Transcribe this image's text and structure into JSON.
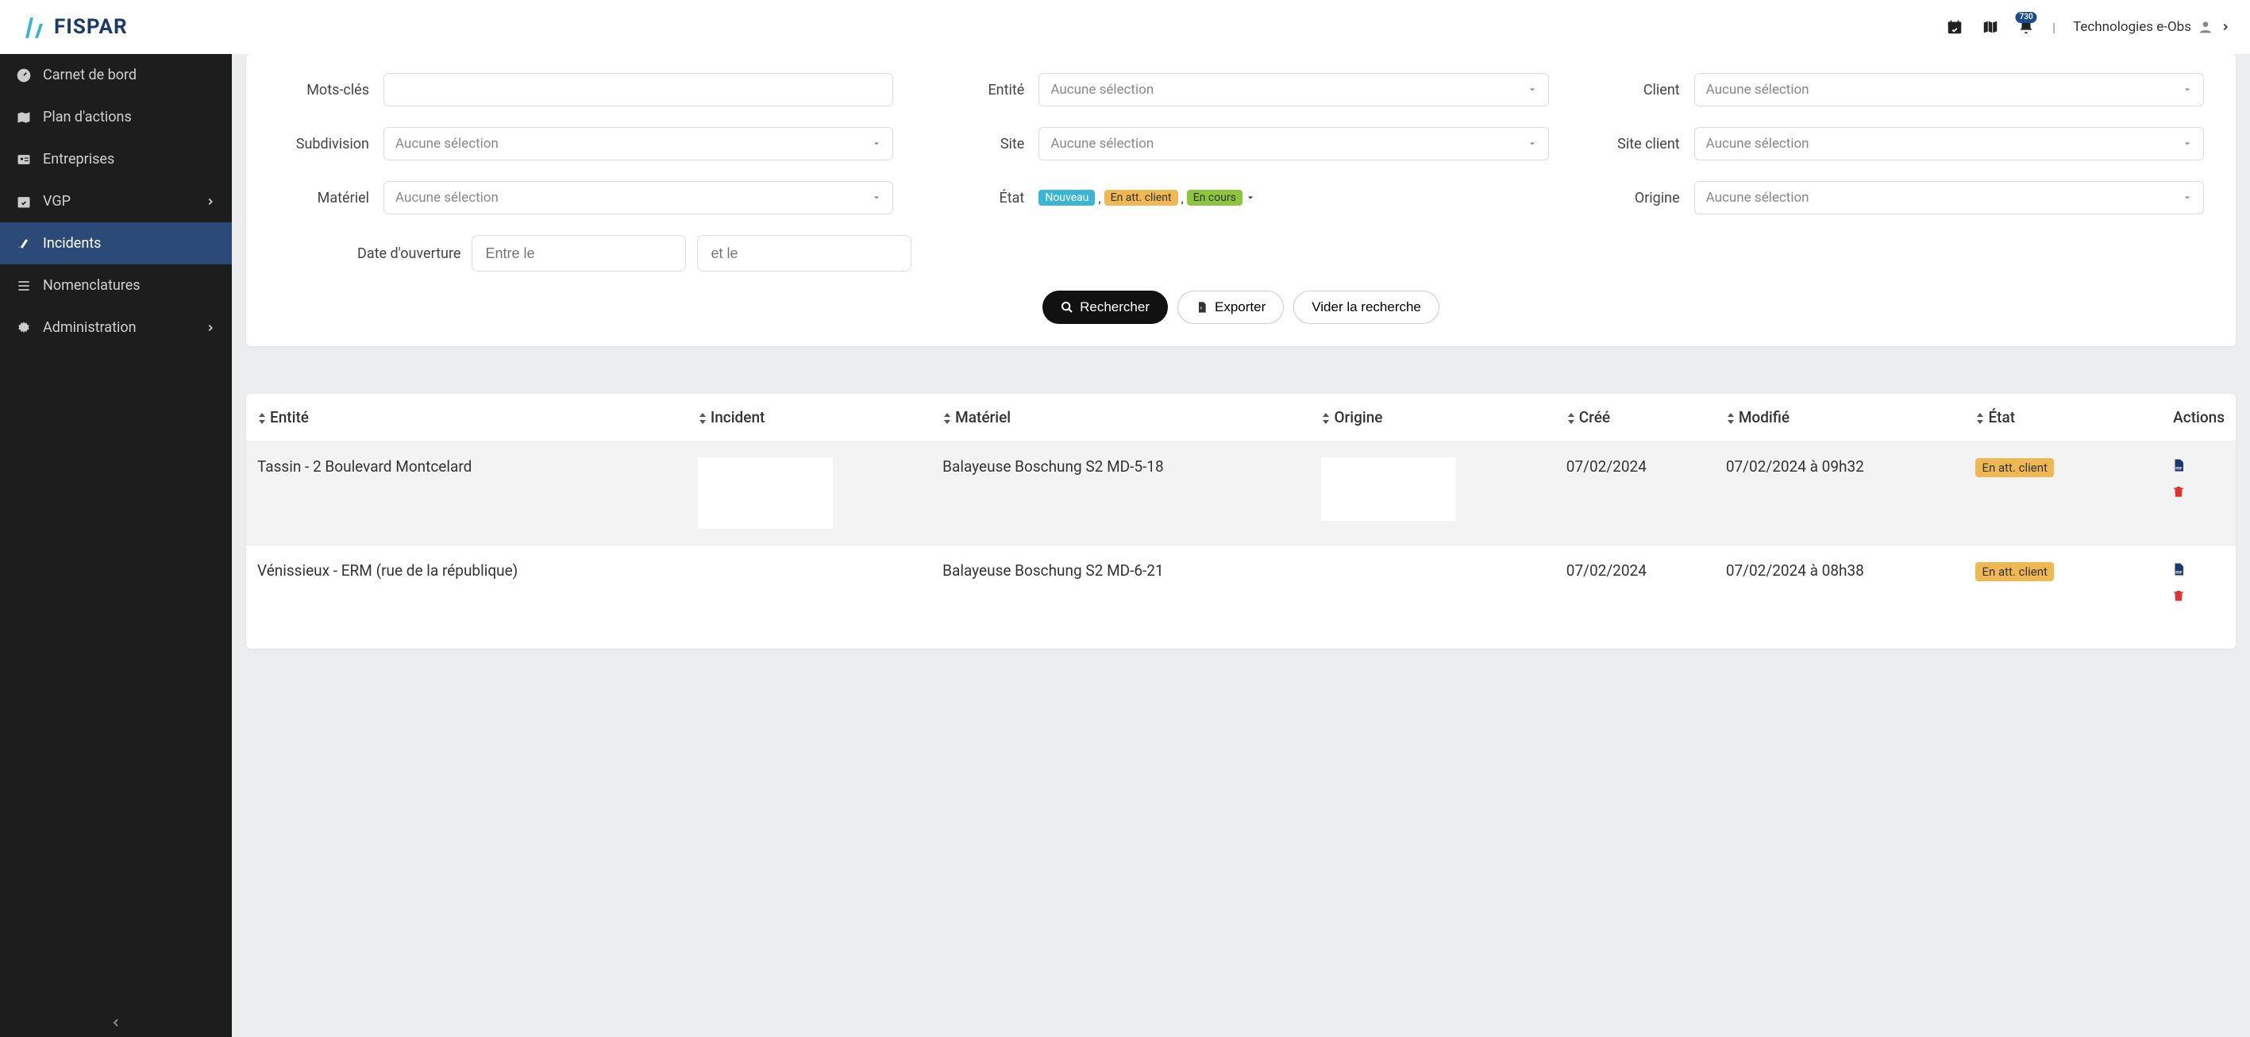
{
  "brand": "FISPAR",
  "notif_count": "730",
  "user_label": "Technologies e-Obs",
  "sidebar": {
    "items": [
      {
        "label": "Carnet de bord",
        "icon": "dashboard"
      },
      {
        "label": "Plan d'actions",
        "icon": "map"
      },
      {
        "label": "Entreprises",
        "icon": "id-card"
      },
      {
        "label": "VGP",
        "icon": "calendar-check",
        "expandable": true
      },
      {
        "label": "Incidents",
        "icon": "brush",
        "active": true
      },
      {
        "label": "Nomenclatures",
        "icon": "list"
      },
      {
        "label": "Administration",
        "icon": "gear",
        "expandable": true
      }
    ]
  },
  "filters": {
    "mots_cles_label": "Mots-clés",
    "entite_label": "Entité",
    "client_label": "Client",
    "subdivision_label": "Subdivision",
    "site_label": "Site",
    "site_client_label": "Site client",
    "materiel_label": "Matériel",
    "etat_label": "État",
    "origine_label": "Origine",
    "placeholder_select": "Aucune sélection",
    "state_tags": {
      "nouveau": "Nouveau",
      "att": "En att. client",
      "cours": "En cours"
    },
    "date_label": "Date d'ouverture",
    "date_from_placeholder": "Entre le",
    "date_to_placeholder": "et le"
  },
  "buttons": {
    "rechercher": "Rechercher",
    "exporter": "Exporter",
    "vider": "Vider la recherche"
  },
  "table": {
    "headers": {
      "entite": "Entité",
      "incident": "Incident",
      "materiel": "Matériel",
      "origine": "Origine",
      "cree": "Créé",
      "modifie": "Modifié",
      "etat": "État",
      "actions": "Actions"
    },
    "rows": [
      {
        "entite": "Tassin - 2 Boulevard Montcelard",
        "incident": "",
        "materiel": "Balayeuse Boschung S2 MD-5-18",
        "origine": "",
        "cree": "07/02/2024",
        "modifie": "07/02/2024 à 09h32",
        "etat": "En att. client"
      },
      {
        "entite": "Vénissieux - ERM (rue de la république)",
        "incident": "",
        "materiel": "Balayeuse Boschung S2 MD-6-21",
        "origine": "",
        "cree": "07/02/2024",
        "modifie": "07/02/2024 à 08h38",
        "etat": "En att. client"
      }
    ]
  }
}
